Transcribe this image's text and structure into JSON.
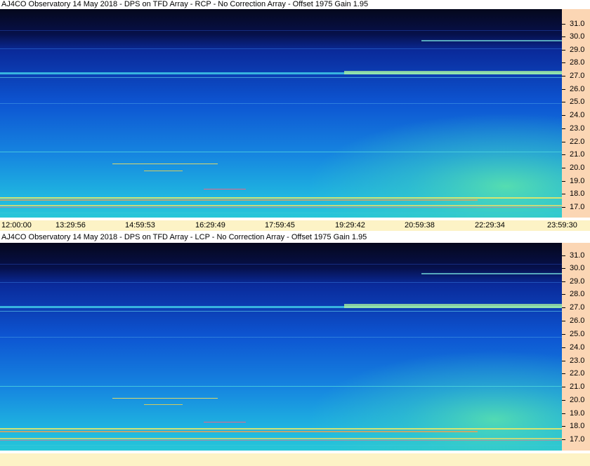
{
  "panels": [
    {
      "title": "AJ4CO Observatory 14 May 2018 - DPS on TFD Array  - RCP  -  No Correction Array  -  Offset 1975  Gain 1.95",
      "polarization": "RCP"
    },
    {
      "title": "AJ4CO Observatory 14 May 2018 - DPS on TFD Array  - LCP  -  No Correction Array  -  Offset 1975  Gain 1.95",
      "polarization": "LCP"
    }
  ],
  "freq_ticks": [
    "31.0",
    "30.0",
    "29.0",
    "28.0",
    "27.0",
    "26.0",
    "25.0",
    "24.0",
    "23.0",
    "22.0",
    "21.0",
    "20.0",
    "19.0",
    "18.0",
    "17.0"
  ],
  "time_ticks": [
    "12:00:00",
    "13:29:56",
    "14:59:53",
    "16:29:49",
    "17:59:45",
    "19:29:42",
    "20:59:38",
    "22:29:34",
    "23:59:30"
  ],
  "colors": {
    "axis_bg": "#fbd6b4",
    "time_bg": "#fdf3c6",
    "spectrum_low": "#0a1a3a",
    "spectrum_mid": "#1f6fd6",
    "spectrum_high": "#33d2c8"
  }
}
